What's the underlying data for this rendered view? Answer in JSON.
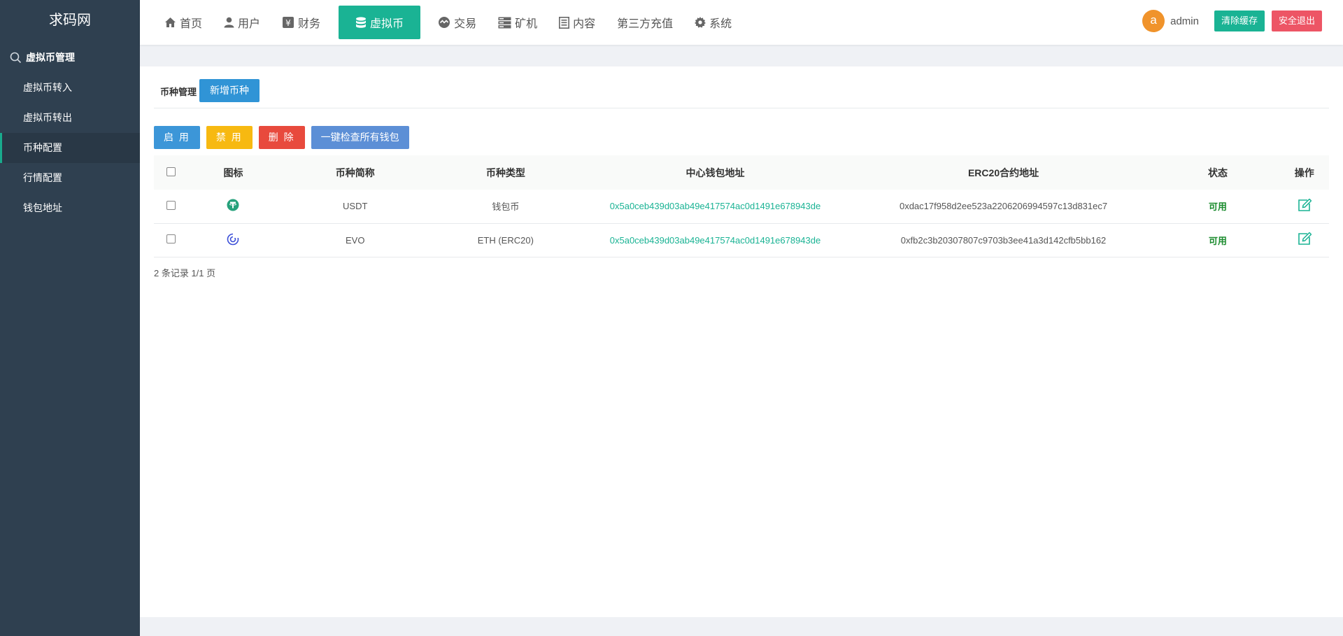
{
  "sidebar": {
    "logo": "求码网",
    "section_title": "虚拟币管理",
    "items": [
      {
        "label": "虚拟币转入"
      },
      {
        "label": "虚拟币转出"
      },
      {
        "label": "币种配置"
      },
      {
        "label": "行情配置"
      },
      {
        "label": "钱包地址"
      }
    ]
  },
  "topnav": {
    "items": [
      {
        "label": "首页",
        "icon": "home-icon"
      },
      {
        "label": "用户",
        "icon": "user-icon"
      },
      {
        "label": "财务",
        "icon": "finance-icon"
      },
      {
        "label": "虚拟币",
        "icon": "database-icon"
      },
      {
        "label": "交易",
        "icon": "exchange-icon"
      },
      {
        "label": "矿机",
        "icon": "server-icon"
      },
      {
        "label": "内容",
        "icon": "document-icon"
      },
      {
        "label": "第三方充值",
        "icon": ""
      },
      {
        "label": "系统",
        "icon": "gear-icon"
      }
    ],
    "avatar_letter": "a",
    "username": "admin",
    "clear_cache": "清除缓存",
    "logout": "安全退出"
  },
  "page": {
    "title": "币种管理",
    "add_button": "新增币种",
    "toolbar": {
      "enable": "启 用",
      "disable": "禁 用",
      "delete": "删 除",
      "check_wallets": "一键检查所有钱包"
    },
    "table": {
      "headers": [
        "图标",
        "币种简称",
        "币种类型",
        "中心钱包地址",
        "ERC20合约地址",
        "状态",
        "操作"
      ],
      "rows": [
        {
          "symbol": "USDT",
          "type": "钱包币",
          "wallet": "0x5a0ceb439d03ab49e417574ac0d1491e678943de",
          "contract": "0xdac17f958d2ee523a2206206994597c13d831ec7",
          "status": "可用"
        },
        {
          "symbol": "EVO",
          "type": "ETH (ERC20)",
          "wallet": "0x5a0ceb439d03ab49e417574ac0d1491e678943de",
          "contract": "0xfb2c3b20307807c9703b3ee41a3d142cfb5bb162",
          "status": "可用"
        }
      ]
    },
    "pagination": "2 条记录 1/1 页"
  },
  "colors": {
    "sidebar_bg": "#2f4050",
    "accent": "#1ab394",
    "danger": "#ed5565"
  }
}
